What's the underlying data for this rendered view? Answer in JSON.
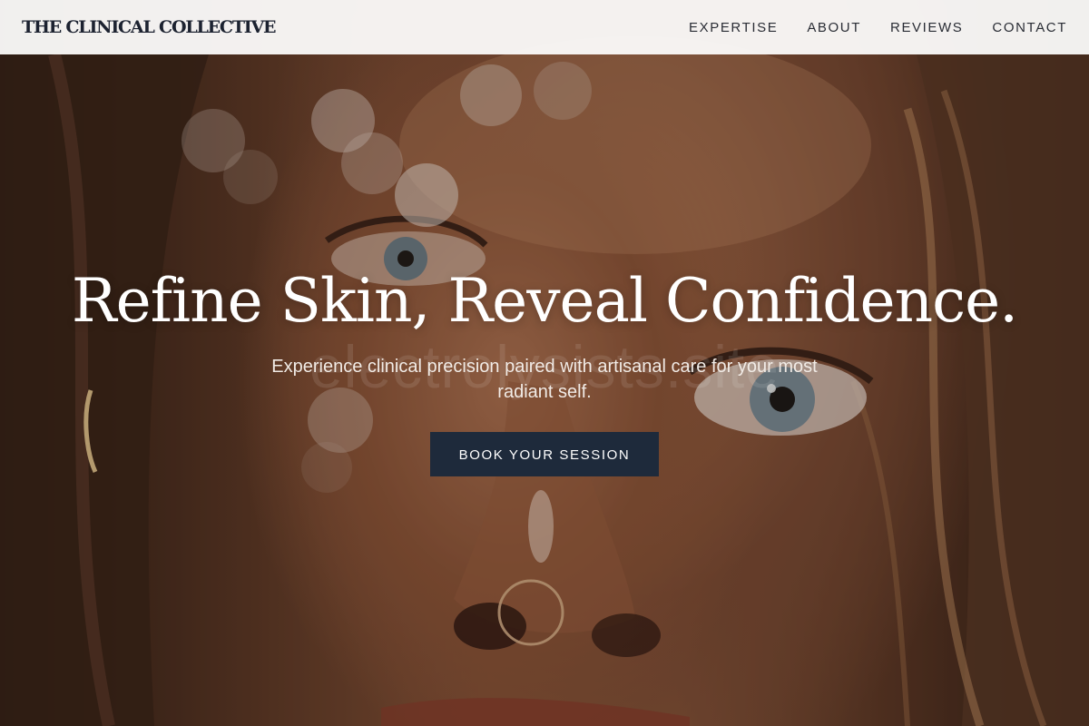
{
  "header": {
    "brand": "THE CLINICAL COLLECTIVE",
    "nav": [
      {
        "label": "EXPERTISE"
      },
      {
        "label": "ABOUT"
      },
      {
        "label": "REVIEWS"
      },
      {
        "label": "CONTACT"
      }
    ]
  },
  "hero": {
    "title": "Refine Skin, Reveal Confidence.",
    "subtitle": "Experience clinical precision paired with artisanal care for your most radiant self.",
    "cta_label": "BOOK YOUR SESSION",
    "watermark": "electrolysists.site",
    "image_description_icon": "portrait-photo"
  },
  "colors": {
    "cta_background": "#1e2a3b",
    "brand_text": "#1c2230",
    "header_background": "#faf9f8"
  }
}
